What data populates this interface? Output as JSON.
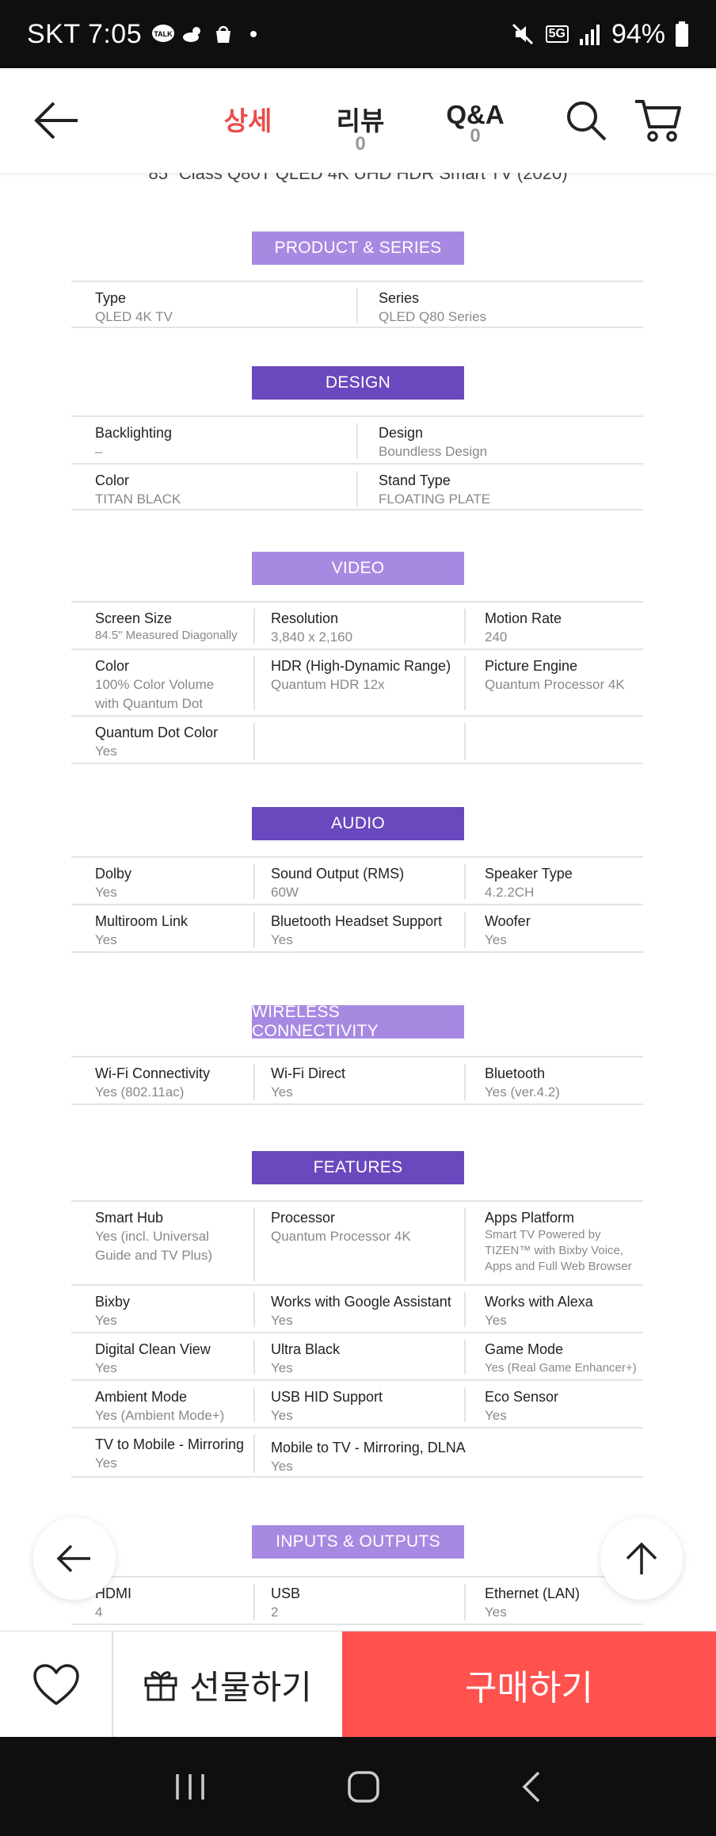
{
  "status_bar": {
    "carrier_time": "SKT 7:05",
    "network": "5G",
    "battery": "94%"
  },
  "app_bar": {
    "tabs": [
      {
        "label": "상세",
        "count": ""
      },
      {
        "label": "리뷰",
        "count": "0"
      },
      {
        "label": "Q&A",
        "count": "0"
      }
    ]
  },
  "cut_title": "85\" Class Q80T QLED 4K UHD HDR Smart TV (2020)",
  "sections": {
    "product": {
      "title": "PRODUCT & SERIES",
      "rows": [
        [
          {
            "k": "Type",
            "v": "QLED 4K TV"
          },
          {
            "k": "Series",
            "v": "QLED Q80 Series"
          }
        ]
      ]
    },
    "design": {
      "title": "DESIGN",
      "rows": [
        [
          {
            "k": "Backlighting",
            "v": "–"
          },
          {
            "k": "Design",
            "v": "Boundless Design"
          }
        ],
        [
          {
            "k": "Color",
            "v": "TITAN BLACK"
          },
          {
            "k": "Stand Type",
            "v": "FLOATING PLATE"
          }
        ]
      ]
    },
    "video": {
      "title": "VIDEO",
      "rows": [
        [
          {
            "k": "Screen Size",
            "v": "84.5\" Measured Diagonally"
          },
          {
            "k": "Resolution",
            "v": "3,840 x 2,160"
          },
          {
            "k": "Motion Rate",
            "v": "240"
          }
        ],
        [
          {
            "k": "Color",
            "v": "100% Color Volume",
            "v2": "with Quantum Dot"
          },
          {
            "k": "HDR (High-Dynamic Range)",
            "v": "Quantum HDR 12x"
          },
          {
            "k": "Picture Engine",
            "v": "Quantum Processor 4K"
          }
        ],
        [
          {
            "k": "Quantum Dot Color",
            "v": "Yes"
          }
        ]
      ]
    },
    "audio": {
      "title": "AUDIO",
      "rows": [
        [
          {
            "k": "Dolby",
            "v": "Yes"
          },
          {
            "k": "Sound Output (RMS)",
            "v": "60W"
          },
          {
            "k": "Speaker Type",
            "v": "4.2.2CH"
          }
        ],
        [
          {
            "k": "Multiroom Link",
            "v": "Yes"
          },
          {
            "k": "Bluetooth Headset Support",
            "v": "Yes"
          },
          {
            "k": "Woofer",
            "v": "Yes"
          }
        ]
      ]
    },
    "wireless": {
      "title": "WIRELESS CONNECTIVITY",
      "rows": [
        [
          {
            "k": "Wi-Fi Connectivity",
            "v": "Yes (802.11ac)"
          },
          {
            "k": "Wi-Fi Direct",
            "v": "Yes"
          },
          {
            "k": "Bluetooth",
            "v": "Yes (ver.4.2)"
          }
        ]
      ]
    },
    "features": {
      "title": "FEATURES",
      "rows": [
        [
          {
            "k": "Smart Hub",
            "v": "Yes (incl. Universal",
            "v2": "Guide and TV Plus)"
          },
          {
            "k": "Processor",
            "v": "Quantum Processor 4K"
          },
          {
            "k": "Apps Platform",
            "v": "Smart TV Powered by",
            "v2": "TIZEN™ with Bixby Voice,",
            "v3": "Apps and Full Web Browser"
          }
        ],
        [
          {
            "k": "Bixby",
            "v": "Yes"
          },
          {
            "k": "Works with Google Assistant",
            "v": "Yes"
          },
          {
            "k": "Works with Alexa",
            "v": "Yes"
          }
        ],
        [
          {
            "k": "Digital Clean View",
            "v": "Yes"
          },
          {
            "k": "Ultra Black",
            "v": "Yes"
          },
          {
            "k": "Game Mode",
            "v": "Yes (Real Game Enhancer+)"
          }
        ],
        [
          {
            "k": "Ambient Mode",
            "v": "Yes (Ambient Mode+)"
          },
          {
            "k": "USB HID Support",
            "v": "Yes"
          },
          {
            "k": "Eco Sensor",
            "v": "Yes"
          }
        ],
        [
          {
            "k": "TV to Mobile - Mirroring",
            "v": "Yes"
          },
          {
            "k": "Mobile to TV - Mirroring, DLNA",
            "v": "Yes"
          }
        ]
      ]
    },
    "io": {
      "title": "INPUTS & OUTPUTS",
      "rows": [
        [
          {
            "k": "HDMI",
            "v": "4"
          },
          {
            "k": "USB",
            "v": "2"
          },
          {
            "k": "Ethernet (LAN)",
            "v": "Yes"
          }
        ]
      ]
    }
  },
  "action_bar": {
    "gift_label": "선물하기",
    "buy_label": "구매하기"
  },
  "colors": {
    "accent_red": "#ff524f",
    "tab_active": "#ea4d4a",
    "header_light": "#a889e2",
    "header_dark": "#6a48bd"
  }
}
